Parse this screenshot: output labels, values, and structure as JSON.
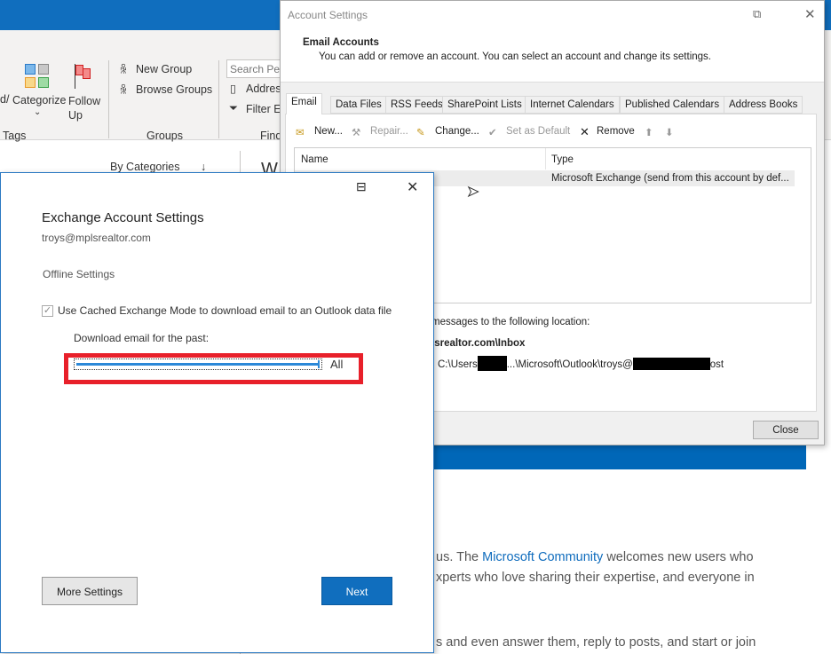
{
  "ribbon": {
    "tags_group": {
      "partial_label": "d/",
      "categorize": "Categorize",
      "follow_up": "Follow Up",
      "label": "Tags"
    },
    "groups_group": {
      "new_group": "New Group",
      "browse_groups": "Browse Groups",
      "label": "Groups"
    },
    "find_group": {
      "search_placeholder": "Search Peo",
      "address_book": "Addres",
      "filter_email": "Filter Er",
      "label": "Find"
    }
  },
  "list_header": {
    "sort": "By Categories",
    "partial_title": "W"
  },
  "content": {
    "line1_prefix": "us. The ",
    "line1_link": "Microsoft Community",
    "line1_suffix": " welcomes new users who",
    "line2": "xperts who love sharing their expertise, and everyone in",
    "line3": "s and even answer them, reply to posts, and start or join"
  },
  "account_settings": {
    "title": "Account Settings",
    "header_title": "Email Accounts",
    "header_desc": "You can add or remove an account. You can select an account and change its settings.",
    "tabs": [
      {
        "label": "Email",
        "active": true
      },
      {
        "label": "Data Files"
      },
      {
        "label": "RSS Feeds"
      },
      {
        "label": "SharePoint Lists"
      },
      {
        "label": "Internet Calendars"
      },
      {
        "label": "Published Calendars"
      },
      {
        "label": "Address Books"
      }
    ],
    "toolbar": {
      "new": "New...",
      "repair": "Repair...",
      "change": "Change...",
      "set_default": "Set as Default",
      "remove": "Remove"
    },
    "columns": {
      "name": "Name",
      "type": "Type"
    },
    "rows": [
      {
        "name": "",
        "type": "Microsoft Exchange (send from this account by def..."
      }
    ],
    "delivery_text": "messages to the following location:",
    "delivery_folder": "lsrealtor.com\\Inbox",
    "path_prefix": "C:\\Users",
    "path_middle": "...\\Microsoft\\Outlook\\troys@",
    "path_suffix": "ost",
    "close": "Close"
  },
  "exchange": {
    "title": "Exchange Account Settings",
    "email": "troys@mplsrealtor.com",
    "section": "Offline Settings",
    "cached_mode_label": "Use Cached Exchange Mode to download email to an Outlook data file",
    "cached_mode_checked": true,
    "download_label": "Download email for the past:",
    "slider_value": "All",
    "slider_fraction": 1.0,
    "more_settings": "More Settings",
    "next": "Next",
    "highlight_color": "#e8202a",
    "accent": "#106ebe"
  }
}
